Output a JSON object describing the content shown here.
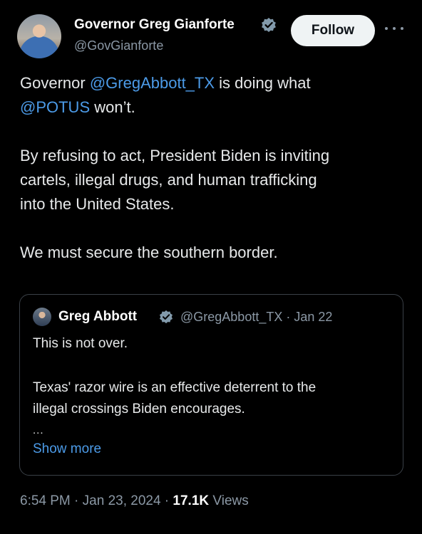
{
  "tweet": {
    "author_name": "Governor Greg Gianforte",
    "handle": "@GovGianforte",
    "follow_label": "Follow",
    "text_lines": [
      [
        {
          "t": "Governor "
        },
        {
          "t": "@GregAbbott_TX",
          "mention": true
        },
        {
          "t": " is doing what"
        }
      ],
      [
        {
          "t": "@POTUS",
          "mention": true
        },
        {
          "t": " won’t."
        }
      ],
      [],
      [
        {
          "t": "By refusing to act, President Biden is inviting"
        }
      ],
      [
        {
          "t": "cartels, illegal drugs, and human trafficking"
        }
      ],
      [
        {
          "t": "into the United States."
        }
      ],
      [],
      [
        {
          "t": "We must secure the southern border."
        }
      ]
    ],
    "time": "6:54 PM",
    "date": "Jan 23, 2024",
    "views_count": "17.1K",
    "views_label": "Views"
  },
  "quote": {
    "author_name": "Greg Abbott",
    "handle": "@GregAbbott_TX",
    "date": "Jan 22",
    "lines": [
      "This is not over.",
      "",
      "Texas' razor wire is an effective deterrent to the",
      "illegal crossings Biden encourages."
    ],
    "ellipsis": "...",
    "show_more": "Show more"
  },
  "colors": {
    "background": "#000000",
    "text": "#e7e9ea",
    "muted": "#8b98a5",
    "link": "#4c9be8",
    "verified": "#829aab",
    "border": "#3a4047"
  },
  "icons": {
    "verified": "verified-badge-icon",
    "more": "more-horizontal-icon"
  }
}
